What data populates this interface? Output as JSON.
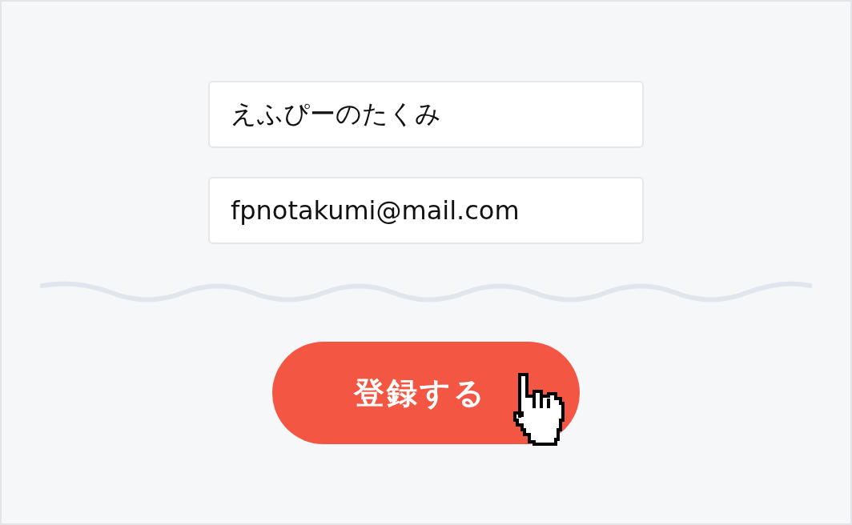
{
  "fields": [
    {
      "value": "えふぴーのたくみ"
    },
    {
      "value": "fpnotakumi@mail.com"
    }
  ],
  "button": {
    "label": "登録する"
  }
}
